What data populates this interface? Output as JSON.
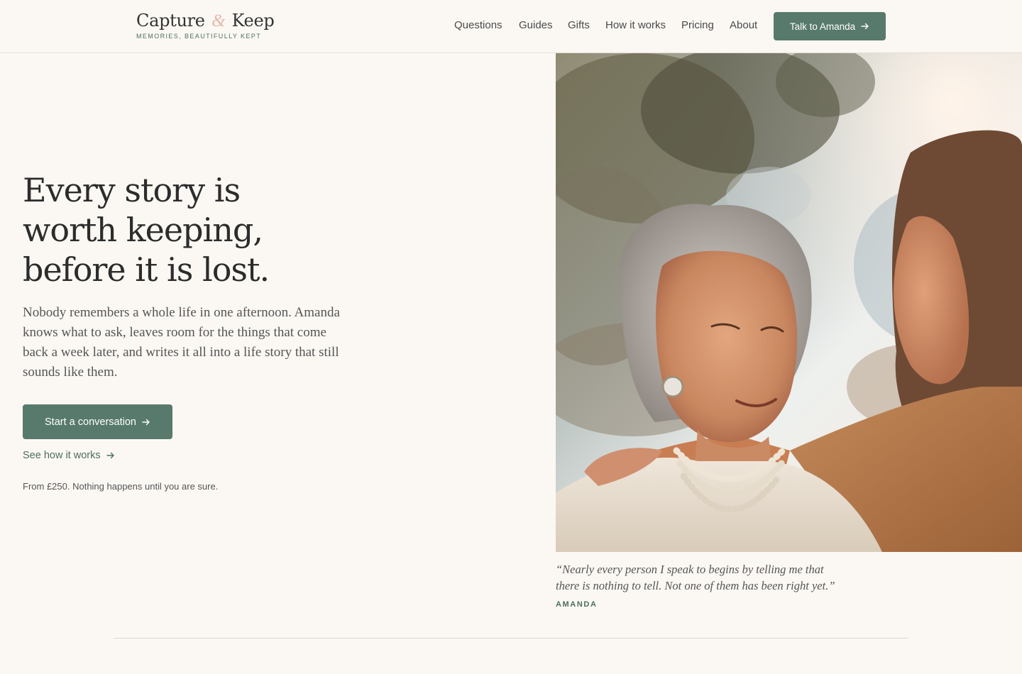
{
  "brand": {
    "name_first": "Capture",
    "name_amp": "&",
    "name_last": "Keep",
    "tagline": "MEMORIES, BEAUTIFULLY KEPT"
  },
  "nav": {
    "items": [
      "Questions",
      "Guides",
      "Gifts",
      "How it works",
      "Pricing",
      "About"
    ],
    "cta_label": "Talk to Amanda"
  },
  "hero": {
    "title_lines": [
      "Every story is",
      "worth keeping,",
      "before it is lost."
    ],
    "body_lines": [
      "Nobody remembers a whole life in one afternoon. Amanda",
      "knows what to ask, leaves room for the things that come",
      "back a week later, and writes it all into a life story that still",
      "sounds like them."
    ],
    "primary_cta": "Start a conversation",
    "secondary_cta": "See how it works",
    "price_note": "From £250. Nothing happens until you are sure."
  },
  "photo": {
    "description_icon": "photo-elderly-woman-and-younger-woman"
  },
  "quote": {
    "lines": [
      "“Nearly every person I speak to begins by telling me that",
      "there is nothing to tell. Not one of them has been right yet.”"
    ],
    "author": "AMANDA"
  },
  "colors": {
    "accent": "#587a6c",
    "background": "#fbf8f3",
    "amp": "#e3b7ad"
  }
}
